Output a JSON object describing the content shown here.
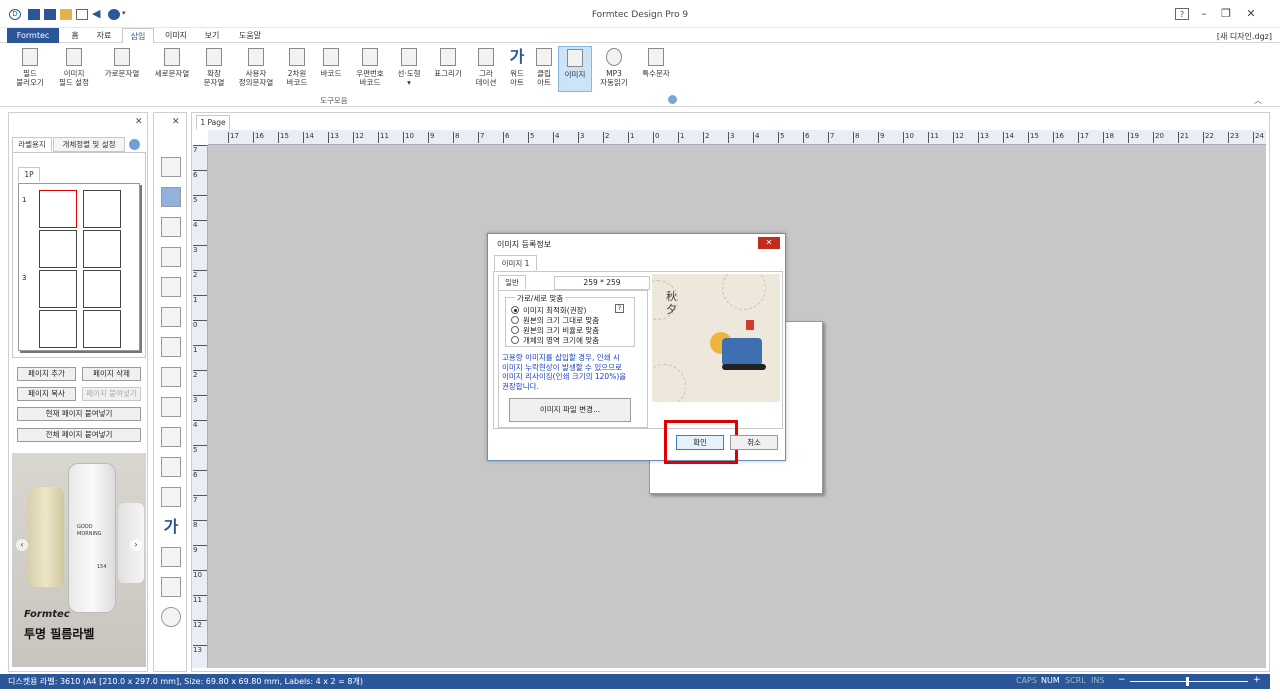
{
  "app": {
    "title": "Formtec Design Pro 9",
    "filename": "[새 디자인.dgz]"
  },
  "tabs": [
    {
      "label": "Formtec"
    },
    {
      "label": "홈"
    },
    {
      "label": "자료"
    },
    {
      "label": "삽입"
    },
    {
      "label": "이미지"
    },
    {
      "label": "보기"
    },
    {
      "label": "도움말"
    }
  ],
  "ribbon": {
    "buttons": [
      {
        "line1": "필드",
        "line2": "불러오기"
      },
      {
        "line1": "이미지",
        "line2": "필드 설정"
      },
      {
        "line1": "가로문자열",
        "line2": ""
      },
      {
        "line1": "세로문자열",
        "line2": ""
      },
      {
        "line1": "확장",
        "line2": "문자열"
      },
      {
        "line1": "사용자",
        "line2": "정의문자열"
      },
      {
        "line1": "2차원",
        "line2": "바코드"
      },
      {
        "line1": "바코드",
        "line2": ""
      },
      {
        "line1": "우편번호",
        "line2": "바코드"
      },
      {
        "line1": "선·도형",
        "line2": "▾"
      },
      {
        "line1": "표그리기",
        "line2": ""
      },
      {
        "line1": "그라",
        "line2": "데이션"
      },
      {
        "line1": "워드",
        "line2": "아트"
      },
      {
        "line1": "클립",
        "line2": "아트"
      },
      {
        "line1": "이미지",
        "line2": ""
      },
      {
        "line1": "MP3",
        "line2": "자동읽기"
      },
      {
        "line1": "특수문자",
        "line2": ""
      }
    ],
    "group_label": "도구모음"
  },
  "left_panel": {
    "tabs": [
      "라벨용지",
      "개체정렬 및 설정"
    ],
    "page_tab": "1P",
    "row_labels": [
      "1",
      "3"
    ],
    "buttons": {
      "add_page": "페이지 추가",
      "delete_page": "페이지 삭제",
      "copy_page": "페이지 복사",
      "paste_page": "페이지 붙여넣기",
      "paste_current": "현재 페이지 붙여넣기",
      "paste_all": "전체 페이지 붙여넣기"
    },
    "ad": {
      "bottle_text1": "GOOD",
      "bottle_text2": "MORNING",
      "bottle_num": "154",
      "brand": "Formtec",
      "caption": "투명 필름라벨"
    }
  },
  "document": {
    "page_tab": "1 Page",
    "hruler_labels": [
      "17",
      "16",
      "15",
      "14",
      "13",
      "12",
      "11",
      "10",
      "9",
      "8",
      "7",
      "6",
      "5",
      "4",
      "3",
      "2",
      "1",
      "0",
      "1",
      "2",
      "3",
      "4",
      "5",
      "6",
      "7",
      "8",
      "9",
      "10",
      "11",
      "12",
      "13",
      "14",
      "15",
      "16",
      "17",
      "18",
      "19",
      "20",
      "21",
      "22",
      "23",
      "24"
    ],
    "vruler_labels": [
      "7",
      "6",
      "5",
      "4",
      "3",
      "2",
      "1",
      "0",
      "1",
      "2",
      "3",
      "4",
      "5",
      "6",
      "7",
      "8",
      "9",
      "10",
      "11",
      "12",
      "13"
    ]
  },
  "dialog": {
    "title": "이미지 등록정보",
    "close": "✕",
    "tab": "이미지 1",
    "subtab": "일반",
    "size": "259 * 259",
    "group_title": "가로/세로 맞춤",
    "options": [
      {
        "label": "이미지 최적화(권장)",
        "selected": true
      },
      {
        "label": "원본의 크기 그대로 맞춤",
        "selected": false
      },
      {
        "label": "원본의 크기 비율로 맞춤",
        "selected": false
      },
      {
        "label": "개체의 영역 크기에 맞춤",
        "selected": false
      }
    ],
    "help": "?",
    "note": [
      "고용량 이미지를 삽입할 경우, 인쇄 시",
      "이미지 누락현상이 발생할 수 있으므로",
      "이미지 리사이징(인쇄 크기의 120%)을",
      "권장합니다."
    ],
    "change_file": "이미지 파일 변경...",
    "ok": "확인",
    "cancel": "취소",
    "preview_text": "秋夕"
  },
  "status": {
    "text": "디스켓용 라벨: 3610 (A4 [210.0 x 297.0 mm], Size: 69.80 x 69.80 mm,  Labels: 4 x 2 = 8개)",
    "indicators": [
      {
        "label": "CAPS",
        "on": false
      },
      {
        "label": "NUM",
        "on": true
      },
      {
        "label": "SCRL",
        "on": false
      },
      {
        "label": "INS",
        "on": false
      }
    ],
    "zoom_minus": "−",
    "zoom_plus": "+"
  },
  "colors": {
    "accent": "#2b579a",
    "highlight": "#e00000"
  }
}
